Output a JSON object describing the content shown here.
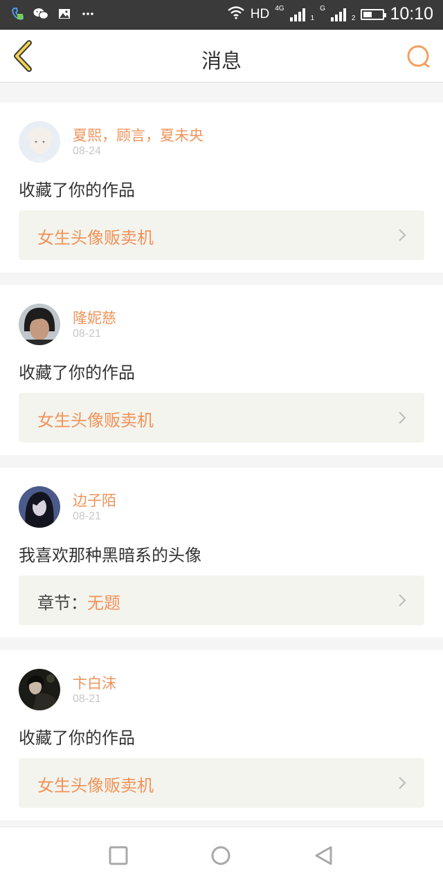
{
  "status_bar": {
    "left_icons": [
      "phone-app-icon",
      "wechat-icon",
      "gallery-icon",
      "more-dots-icon"
    ],
    "hd_label": "HD",
    "network_4g": "4G",
    "sim1": "1",
    "network_g": "G",
    "sim2": "2",
    "battery_level": 0.45,
    "time": "10:10"
  },
  "header": {
    "title": "消息",
    "back_icon": "chevron-left-icon",
    "search_icon": "search-icon"
  },
  "accent_color": "#f0935a",
  "notifications": [
    {
      "name": "夏熙，顾言，夏未央",
      "date": "08-24",
      "message": "收藏了你的作品",
      "link_prefix": "",
      "link_text": "女生头像贩卖机"
    },
    {
      "name": "隆妮慈",
      "date": "08-21",
      "message": "收藏了你的作品",
      "link_prefix": "",
      "link_text": "女生头像贩卖机"
    },
    {
      "name": "边子陌",
      "date": "08-21",
      "message": "我喜欢那种黑暗系的头像",
      "link_prefix": "章节：",
      "link_text": "无题"
    },
    {
      "name": "卞白沫",
      "date": "08-21",
      "message": "收藏了你的作品",
      "link_prefix": "",
      "link_text": "女生头像贩卖机"
    }
  ],
  "nav_bar": {
    "recent_icon": "square-recent-icon",
    "home_icon": "circle-home-icon",
    "back_icon": "triangle-back-icon"
  }
}
